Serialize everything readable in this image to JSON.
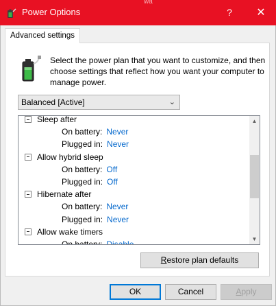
{
  "window": {
    "title": "Power Options",
    "help_glyph": "?",
    "close_glyph": "✕",
    "bg_partial_text": "wa"
  },
  "tab": {
    "label": "Advanced settings"
  },
  "description": "Select the power plan that you want to customize, and then choose settings that reflect how you want your computer to manage power.",
  "plan_select": {
    "value": "Balanced [Active]"
  },
  "tree": [
    {
      "type": "category",
      "label": "Sleep after"
    },
    {
      "type": "setting",
      "label": "On battery:",
      "value": "Never"
    },
    {
      "type": "setting",
      "label": "Plugged in:",
      "value": "Never"
    },
    {
      "type": "category",
      "label": "Allow hybrid sleep"
    },
    {
      "type": "setting",
      "label": "On battery:",
      "value": "Off"
    },
    {
      "type": "setting",
      "label": "Plugged in:",
      "value": "Off"
    },
    {
      "type": "category",
      "label": "Hibernate after"
    },
    {
      "type": "setting",
      "label": "On battery:",
      "value": "Never"
    },
    {
      "type": "setting",
      "label": "Plugged in:",
      "value": "Never"
    },
    {
      "type": "category",
      "label": "Allow wake timers"
    },
    {
      "type": "setting",
      "label": "On battery:",
      "value": "Disable"
    }
  ],
  "scrollbar": {
    "position_fraction": 0.45,
    "visible_fraction": 0.4
  },
  "buttons": {
    "restore": {
      "underlined": "R",
      "rest": "estore plan defaults"
    },
    "ok": "OK",
    "cancel": "Cancel",
    "apply": {
      "underlined": "A",
      "rest": "pply"
    }
  },
  "icons": {
    "app": "power-options-icon",
    "battery": "battery-plug-icon"
  },
  "colors": {
    "titlebar": "#e81123",
    "link": "#0066cc",
    "focus": "#0078d7"
  }
}
